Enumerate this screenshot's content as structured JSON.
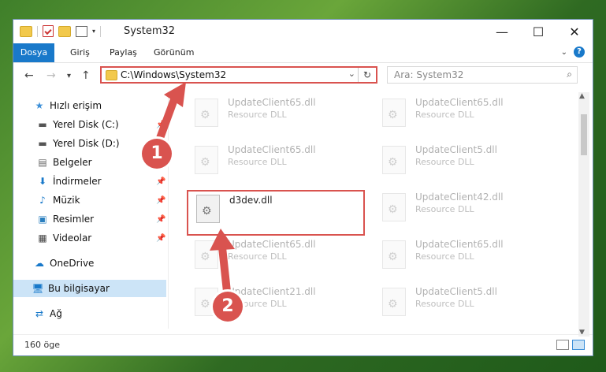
{
  "window": {
    "title": "System32",
    "controls": {
      "minimize": "—",
      "maximize": "☐",
      "close": "✕"
    }
  },
  "ribbon": {
    "tabs": [
      "Dosya",
      "Giriş",
      "Paylaş",
      "Görünüm"
    ]
  },
  "address": {
    "path": "C:\\Windows\\System32",
    "search_placeholder": "Ara: System32"
  },
  "sidebar": {
    "items": [
      {
        "label": "Hızlı erişim",
        "icon": "star-icon"
      },
      {
        "label": "Yerel Disk (C:)",
        "icon": "drive-icon"
      },
      {
        "label": "Yerel Disk (D:)",
        "icon": "drive-icon"
      },
      {
        "label": "Belgeler",
        "icon": "documents-icon"
      },
      {
        "label": "İndirmeler",
        "icon": "download-icon"
      },
      {
        "label": "Müzik",
        "icon": "music-icon"
      },
      {
        "label": "Resimler",
        "icon": "pictures-icon"
      },
      {
        "label": "Videolar",
        "icon": "video-icon"
      },
      {
        "label": "OneDrive",
        "icon": "cloud-icon"
      },
      {
        "label": "Bu bilgisayar",
        "icon": "computer-icon"
      },
      {
        "label": "Ağ",
        "icon": "network-icon"
      }
    ]
  },
  "files": [
    {
      "name": "UpdateClient65.dll",
      "type": "Resource DLL"
    },
    {
      "name": "UpdateClient65.dll",
      "type": "Resource DLL"
    },
    {
      "name": "UpdateClient65.dll",
      "type": "Resource DLL"
    },
    {
      "name": "UpdateClient5.dll",
      "type": "Resource DLL"
    },
    {
      "name": "d3dev.dll",
      "type": ""
    },
    {
      "name": "UpdateClient42.dll",
      "type": "Resource DLL"
    },
    {
      "name": "UpdateClient65.dll",
      "type": "Resource DLL"
    },
    {
      "name": "UpdateClient65.dll",
      "type": "Resource DLL"
    },
    {
      "name": "UpdateClient21.dll",
      "type": "Resource DLL"
    },
    {
      "name": "UpdateClient5.dll",
      "type": "Resource DLL"
    }
  ],
  "status": {
    "count": "160 öge"
  },
  "steps": {
    "one": "1",
    "two": "2"
  },
  "colors": {
    "accent": "#1979ca",
    "highlight": "#d9534f"
  }
}
